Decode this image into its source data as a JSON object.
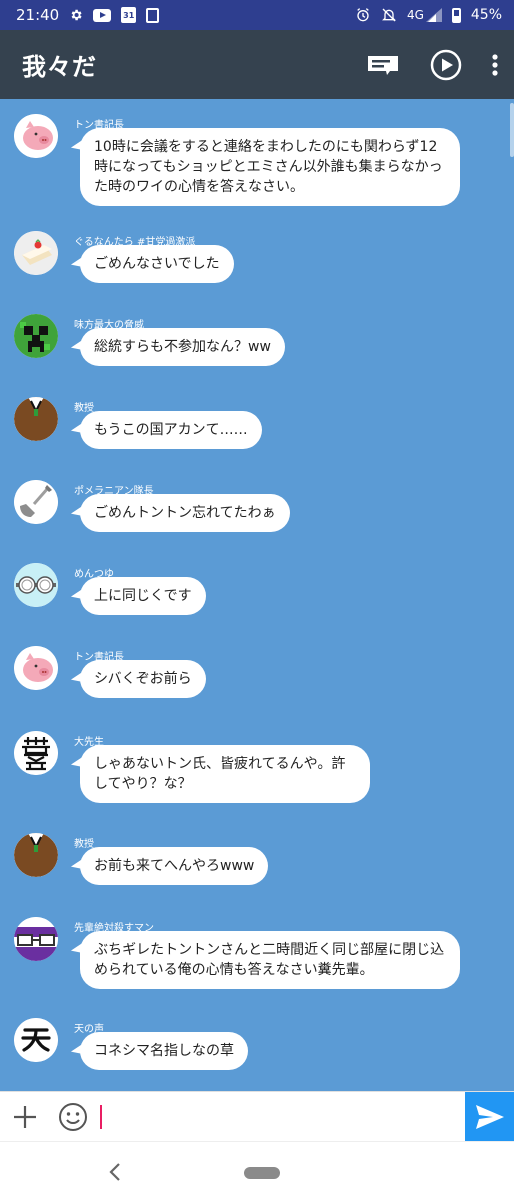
{
  "status_bar": {
    "time": "21:40",
    "network": "4G",
    "battery": "45%",
    "calendar_day": "31",
    "icons": [
      "gear-icon",
      "youtube-icon",
      "calendar-icon",
      "app-icon",
      "alarm-icon",
      "mute-icon",
      "signal-icon",
      "battery-icon"
    ]
  },
  "app_bar": {
    "title": "我々だ",
    "actions": [
      "comment-icon",
      "play-icon",
      "more-vert-icon"
    ]
  },
  "colors": {
    "status_bar": "#2e3e8f",
    "app_bar": "#35424f",
    "chat_background": "#5b9bd5",
    "bubble": "#ffffff",
    "send_button": "#2196f3",
    "cursor": "#e91e63"
  },
  "messages": [
    {
      "sender": "トン書記長",
      "avatar": "pig-avatar",
      "text": "10時に会議をすると連絡をまわしたのにも関わらず12時になってもショッピとエミさん以外誰も集まらなかった時のワイの心情を答えなさい。"
    },
    {
      "sender": "ぐるなんたら #甘党過激派",
      "avatar": "cake-avatar",
      "text": "ごめんなさいでした"
    },
    {
      "sender": "味方最大の脅威",
      "avatar": "creeper-avatar",
      "text": "総統すらも不参加なん？ww"
    },
    {
      "sender": "教授",
      "avatar": "suit-avatar",
      "text": "もうこの国アカンて……"
    },
    {
      "sender": "ポメラニアン隊長",
      "avatar": "shovel-avatar",
      "text": "ごめんトントン忘れてたわぁ"
    },
    {
      "sender": "めんつゆ",
      "avatar": "goggles-avatar",
      "text": "上に同じくです"
    },
    {
      "sender": "トン書記長",
      "avatar": "pig-avatar",
      "text": "シバくぞお前ら"
    },
    {
      "sender": "大先生",
      "avatar": "kanji-utsu-avatar",
      "text": "しゃあないトン氏、皆疲れてるんや。許してやり？な？"
    },
    {
      "sender": "教授",
      "avatar": "suit-avatar",
      "text": "お前も来てへんやろwww"
    },
    {
      "sender": "先輩絶対殺すマン",
      "avatar": "glasses-avatar",
      "text": "ぶちギレたトントンさんと二時間近く同じ部屋に閉じ込められている俺の心情も答えなさい糞先輩。"
    },
    {
      "sender": "天の声",
      "avatar": "kanji-ten-avatar",
      "text": "コネシマ名指しなの草"
    }
  ],
  "input_bar": {
    "placeholder": "",
    "value": "",
    "icons": [
      "plus-icon",
      "emoji-icon",
      "send-icon"
    ]
  },
  "nav_bar": {
    "icons": [
      "back-icon",
      "home-icon"
    ]
  }
}
